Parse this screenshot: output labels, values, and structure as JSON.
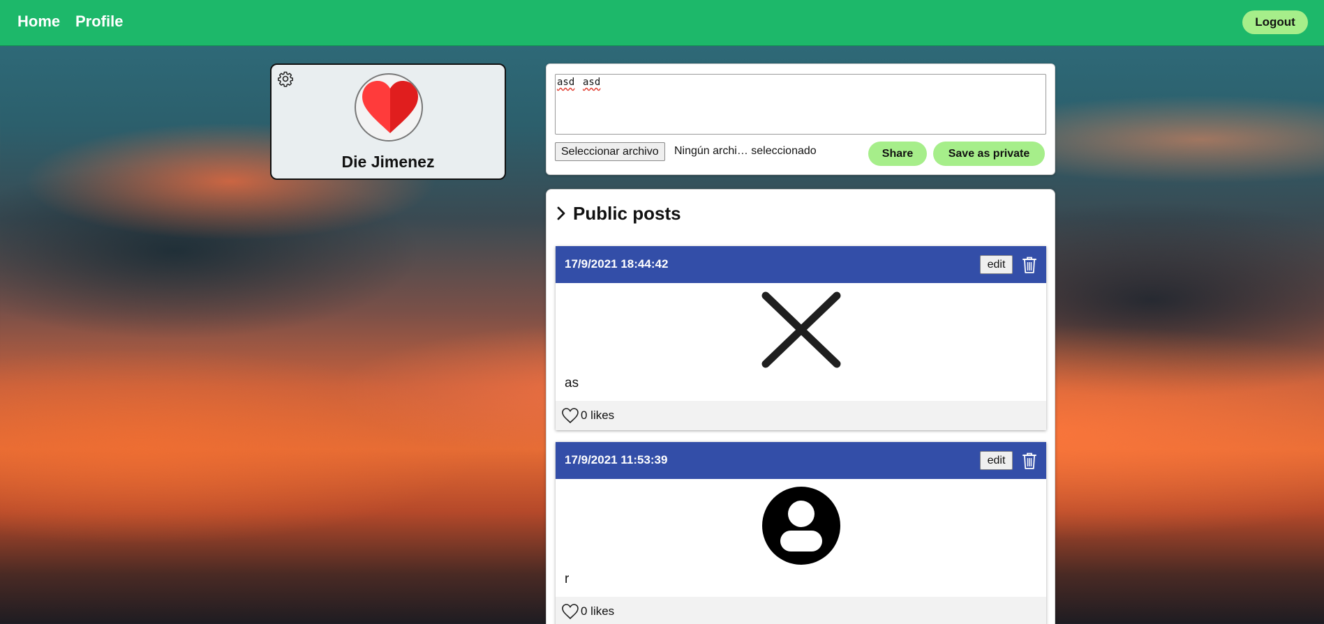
{
  "nav": {
    "home_label": "Home",
    "profile_label": "Profile",
    "logout_label": "Logout"
  },
  "colors": {
    "navbar": "#1db86a",
    "accent_button": "#a6ee8a",
    "post_header": "#334ea8"
  },
  "profile": {
    "name": "Die Jimenez",
    "settings_icon": "gear-icon",
    "avatar_icon": "heart-icon"
  },
  "composer": {
    "text_value": "asd asd",
    "text_words": [
      "asd",
      "asd"
    ],
    "file_button_label": "Seleccionar archivo",
    "file_status": "Ningún archi… seleccionado",
    "share_label": "Share",
    "private_label": "Save as private"
  },
  "posts": {
    "title": "Public posts",
    "items": [
      {
        "date": "17/9/2021 18:44:42",
        "edit_label": "edit",
        "image_icon": "close-x-icon",
        "text": "as",
        "likes": "0 likes"
      },
      {
        "date": "17/9/2021 11:53:39",
        "edit_label": "edit",
        "image_icon": "user-avatar-icon",
        "text": "r",
        "likes": "0 likes"
      }
    ]
  }
}
